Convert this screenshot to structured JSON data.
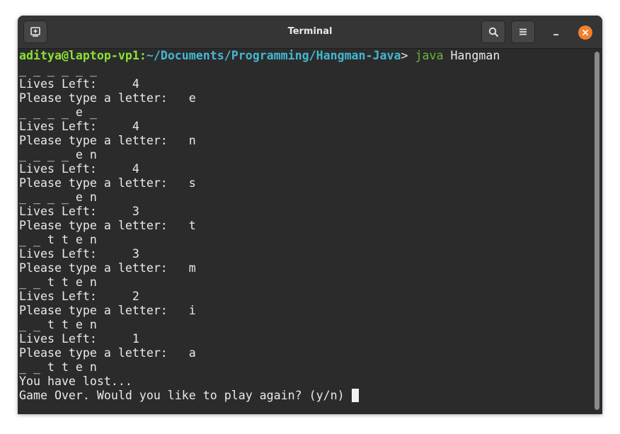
{
  "window": {
    "title": "Terminal",
    "buttons": [
      "new-tab-icon",
      "search-icon",
      "menu-icon",
      "minimize-icon",
      "close-icon"
    ]
  },
  "colors": {
    "user": "#8ae234",
    "path": "#44b7d3",
    "command": "#6db33f",
    "close_button": "#f0812d",
    "background": "#2b2b2b"
  },
  "terminal": {
    "prompt": {
      "user_host": "aditya@laptop-vp1",
      "separator": ":",
      "path": "~/Documents/Programming/Hangman-Java",
      "symbol": "> ",
      "command": "java",
      "argument": " Hangman"
    },
    "output": [
      "_ _ _ _ _ _",
      "Lives Left:     4",
      "Please type a letter:   e",
      "_ _ _ _ e _",
      "Lives Left:     4",
      "Please type a letter:   n",
      "_ _ _ _ e n",
      "Lives Left:     4",
      "Please type a letter:   s",
      "_ _ _ _ e n",
      "Lives Left:     3",
      "Please type a letter:   t",
      "_ _ t t e n",
      "Lives Left:     3",
      "Please type a letter:   m",
      "_ _ t t e n",
      "Lives Left:     2",
      "Please type a letter:   i",
      "_ _ t t e n",
      "Lives Left:     1",
      "Please type a letter:   a",
      "_ _ t t e n",
      "You have lost...",
      "Game Over. Would you like to play again? (y/n)"
    ]
  }
}
